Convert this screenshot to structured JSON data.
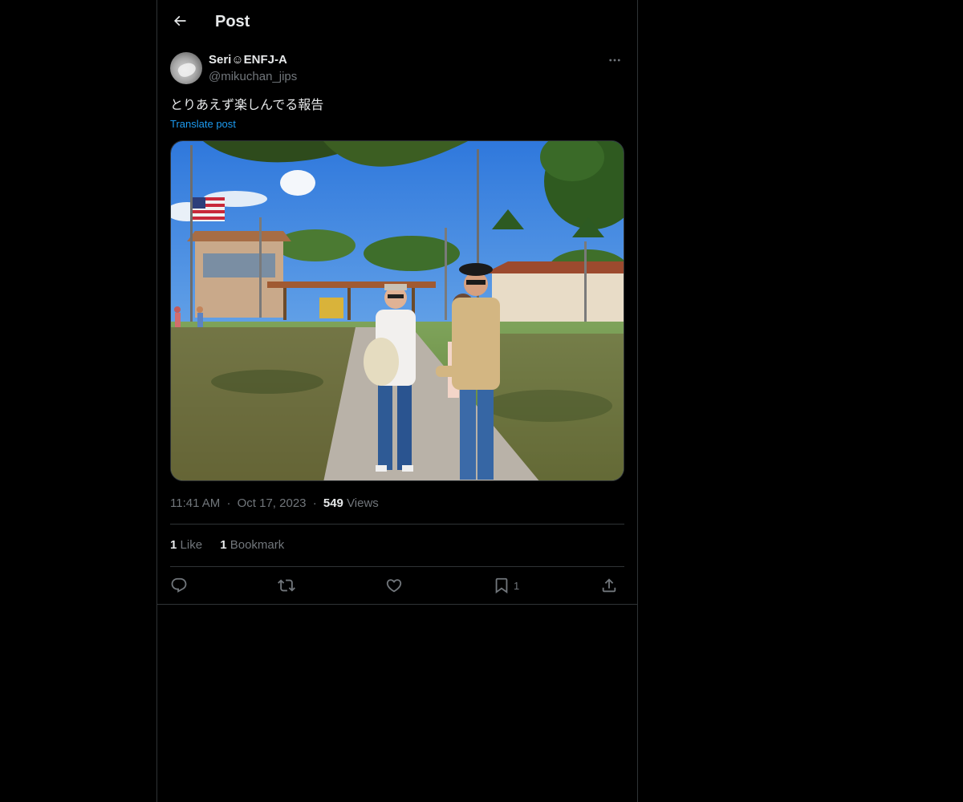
{
  "header": {
    "title": "Post"
  },
  "post": {
    "author": {
      "display_name": "Seri☺︎ENFJ-A",
      "handle": "@mikuchan_jips"
    },
    "text": "とりあえず楽しんでる報告",
    "translate_label": "Translate post",
    "time": "11:41 AM",
    "date": "Oct 17, 2023",
    "separator": "·",
    "views_count": "549",
    "views_label": "Views",
    "stats": {
      "likes_count": "1",
      "likes_label": "Like",
      "bookmarks_count": "1",
      "bookmarks_label": "Bookmark"
    },
    "actions": {
      "bookmark_count": "1"
    }
  },
  "icons": {
    "back": "arrow-left-icon",
    "more": "more-horizontal-icon",
    "reply": "reply-icon",
    "repost": "repost-icon",
    "like": "heart-icon",
    "bookmark": "bookmark-icon",
    "share": "share-icon"
  },
  "colors": {
    "background": "#000000",
    "text": "#e7e9ea",
    "muted": "#71767b",
    "border": "#2f3336",
    "accent": "#1d9bf0"
  }
}
